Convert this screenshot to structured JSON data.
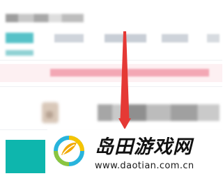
{
  "screen": {
    "accent_color": "#0eb6ad",
    "highlight_color": "#f3a7b4",
    "arrow_color": "#e53935"
  },
  "watermark": {
    "site_name": "岛田游戏网",
    "url": "www.daotian.com.cn",
    "logo_icon": "daotian-logo-icon"
  },
  "annotation": {
    "arrow_icon": "down-arrow-icon"
  }
}
